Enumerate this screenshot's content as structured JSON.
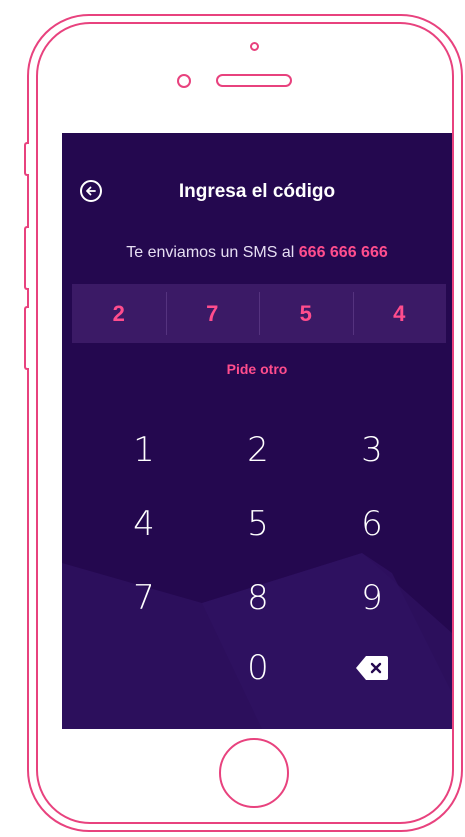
{
  "header": {
    "title": "Ingresa el código",
    "back_icon": "arrow-left-circle-icon"
  },
  "message": {
    "text": "Te enviamos un SMS al ",
    "phone": "666 666 666"
  },
  "code": {
    "digits": [
      "2",
      "7",
      "5",
      "4"
    ]
  },
  "resend_label": "Pide otro",
  "keypad": {
    "keys": [
      "1",
      "2",
      "3",
      "4",
      "5",
      "6",
      "7",
      "8",
      "9",
      "0"
    ],
    "delete_icon": "backspace-icon"
  },
  "colors": {
    "accent": "#ff4d8d",
    "background": "#24084f",
    "frame": "#e8427e"
  }
}
